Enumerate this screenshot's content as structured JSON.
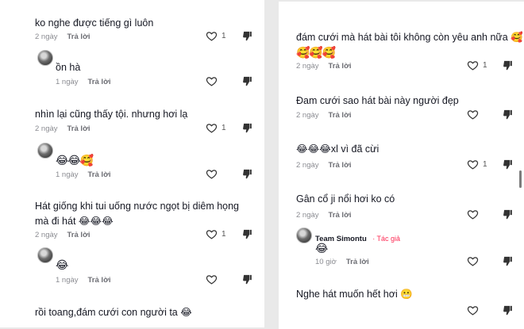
{
  "left_panel": {
    "comments": [
      {
        "text": "ko nghe được tiếng gì luôn",
        "time": "2 ngày",
        "reply": "Trả lời",
        "likes": "1"
      },
      {
        "text": "ồn hà",
        "time": "1 ngày",
        "reply": "Trả lời",
        "likes": ""
      },
      {
        "text": "nhìn lại cũng thấy tội. nhưng hơi lạ",
        "time": "2 ngày",
        "reply": "Trả lời",
        "likes": "1"
      },
      {
        "text": "😂😂🥰",
        "time": "1 ngày",
        "reply": "Trả lời",
        "likes": ""
      },
      {
        "text": "Hát giống khi tui uống nước ngọt bị diêm họng mà đi hát 😂😂😂",
        "time": "2 ngày",
        "reply": "Trả lời",
        "likes": "1"
      },
      {
        "text": "😂",
        "time": "1 ngày",
        "reply": "Trả lời",
        "likes": ""
      },
      {
        "text": "rồi toang,đám cưới con người ta 😂",
        "time": "",
        "reply": "",
        "likes": ""
      }
    ]
  },
  "right_panel": {
    "comments": [
      {
        "text": "đám cưới mà hát bài tôi không còn yêu anh nữa 🥰",
        "emoji": "🥰🥰🥰",
        "time": "2 ngày",
        "reply": "Trả lời",
        "likes": "1"
      },
      {
        "text": "Đam cưới sao hát bài này người đẹp",
        "time": "2 ngày",
        "reply": "Trả lời",
        "likes": ""
      },
      {
        "text": "😂😂😂xl vì đã cừi",
        "time": "2 ngày",
        "reply": "Trả lời",
        "likes": "1"
      },
      {
        "text": "Gân cổ ji nổi hơi ko có",
        "time": "2 ngày",
        "reply": "Trả lời",
        "likes": ""
      },
      {
        "author": "Team Simontu",
        "badge": "· Tác giả",
        "text": "😂",
        "time": "10 giờ",
        "reply": "Trả lời",
        "likes": ""
      },
      {
        "text": "Nghe hát muốn hết hơi 😬",
        "time": "",
        "reply": "",
        "likes": ""
      }
    ]
  },
  "icons": {
    "like": "heart-icon",
    "dislike": "thumbs-down-icon"
  },
  "colors": {
    "text": "#161823",
    "meta": "#8a8b91",
    "author_badge": "#fe2c55"
  }
}
